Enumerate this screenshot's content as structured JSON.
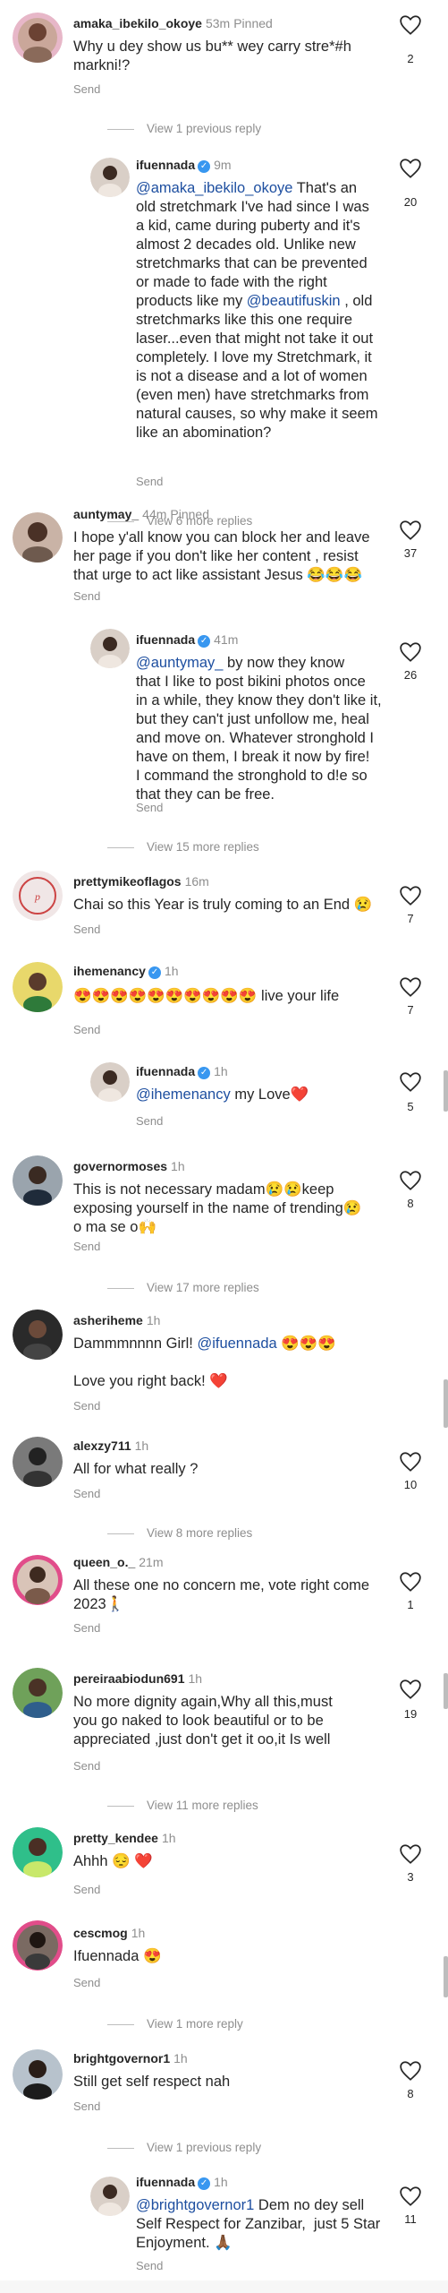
{
  "colors": {
    "heart": "#262626",
    "verified": "#3897f0",
    "mention": "#1e4fa0",
    "grey": "#8e8e8e"
  },
  "send_label": "Send",
  "c1": {
    "user": "amaka_ibekilo_okoye",
    "time": "53m",
    "pinned": "Pinned",
    "text": "Why u dey show us bu** wey carry stre*#h\nmarkni!?",
    "likes": "2"
  },
  "r1_view": "View 1 previous reply",
  "r1": {
    "user": "ifuennada",
    "time": "9m",
    "mention": "@amaka_ibekilo_okoye",
    "text_a": " That's an\nold stretchmark I've had since I was\na kid, came during puberty and it's\nalmost 2 decades old. Unlike new\nstretchmarks that can be prevented\nor made to fade with the right\nproducts like my ",
    "mention2": "@beautifuskin",
    "text_b": " , old\nstretchmarks like this one require\nlaser...even that might not take it out\ncompletely. I love my Stretchmark, it\nis not a disease and a lot of women\n(even men) have stretchmarks from\nnatural causes, so why make it seem\nlike an abomination?",
    "likes": "20"
  },
  "r1_more": "View 6 more replies",
  "c2": {
    "user": "auntymay_",
    "time": "44m",
    "pinned": "Pinned",
    "text": "I hope y'all know you can block her and leave\nher page if you don't like her content , resist\nthat urge to act like assistant Jesus 😂😂😂",
    "likes": "37"
  },
  "r2": {
    "user": "ifuennada",
    "time": "41m",
    "mention": "@auntymay_",
    "text": " by now they know\nthat I like to post bikini photos once\nin a while, they know they don't like it,\nbut they can't just unfollow me, heal\nand move on. Whatever stronghold I\nhave on them, I break it now by fire!\nI command the stronghold to d!e so\nthat they can be free.",
    "likes": "26"
  },
  "r2_more": "View 15 more replies",
  "c3": {
    "user": "prettymikeoflagos",
    "time": "16m",
    "text": "Chai so this Year is truly coming to an End 😢",
    "likes": "7"
  },
  "c4": {
    "user": "ihemenancy",
    "time": "1h",
    "text": "😍😍😍😍😍😍😍😍😍😍 live your life",
    "likes": "7"
  },
  "r4": {
    "user": "ifuennada",
    "time": "1h",
    "mention": "@ihemenancy",
    "text": " my Love❤️",
    "likes": "5"
  },
  "c5": {
    "user": "governormoses",
    "time": "1h",
    "text": "This is not necessary madam😢😢keep\nexposing yourself in the name of trending😢\no ma se o🙌",
    "likes": "8"
  },
  "c5_more": "View 17 more replies",
  "c6": {
    "user": "asheriheme",
    "time": "1h",
    "text_a": "Dammmnnnn Girl! ",
    "mention": "@ifuennada",
    "text_b": " 😍😍😍\n\nLove you right back! ❤️"
  },
  "c7": {
    "user": "alexzy711",
    "time": "1h",
    "text": "All for what really ?",
    "likes": "10"
  },
  "c7_more": "View 8 more replies",
  "c8": {
    "user": "queen_o._",
    "time": "21m",
    "text": "All these one no concern me, vote right come\n2023🚶",
    "likes": "1"
  },
  "c9": {
    "user": "pereiraabiodun691",
    "time": "1h",
    "text": "No more dignity again,Why all this,must\nyou go naked to look beautiful or to be\nappreciated ,just don't get it oo,it Is well",
    "likes": "19"
  },
  "c9_more": "View 11 more replies",
  "c10": {
    "user": "pretty_kendee",
    "time": "1h",
    "text": "Ahhh 😔 ❤️",
    "likes": "3"
  },
  "c11": {
    "user": "cescmog",
    "time": "1h",
    "text": "Ifuennada 😍"
  },
  "c11_more": "View 1 more reply",
  "c12": {
    "user": "brightgovernor1",
    "time": "1h",
    "text": "Still get self respect nah",
    "likes": "8"
  },
  "c12_prev": "View 1 previous reply",
  "r12": {
    "user": "ifuennada",
    "time": "1h",
    "mention": "@brightgovernor1",
    "text": " Dem no dey sell\nSelf Respect for Zanzibar,  just 5 Star\nEnjoyment. 🙏🏾",
    "likes": "11"
  }
}
